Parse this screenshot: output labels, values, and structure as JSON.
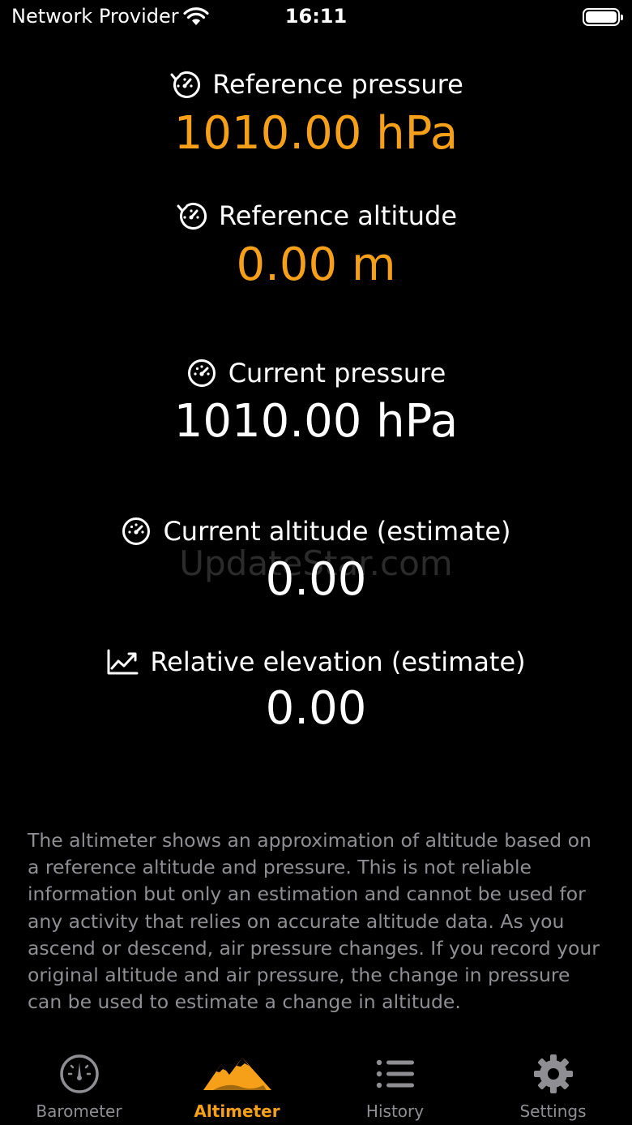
{
  "status_bar": {
    "carrier": "Network Provider",
    "time": "16:11"
  },
  "metrics": {
    "reference_pressure": {
      "label": "Reference pressure",
      "value": "1010.00 hPa",
      "icon": "timer-reset-icon"
    },
    "reference_altitude": {
      "label": "Reference altitude",
      "value": "0.00 m",
      "icon": "timer-reset-icon"
    },
    "current_pressure": {
      "label": "Current pressure",
      "value": "1010.00 hPa",
      "icon": "gauge-icon"
    },
    "current_altitude": {
      "label": "Current altitude (estimate)",
      "value": "0.00",
      "icon": "gauge-icon"
    },
    "relative_elevation": {
      "label": "Relative elevation (estimate)",
      "value": "0.00",
      "icon": "chart-line-icon"
    }
  },
  "watermark": "UpdateStar.com",
  "description": "The altimeter shows an approximation of altitude based on a reference altitude and pressure. This is not reliable information but only an estimation and cannot be used for any activity that relies on accurate altitude data. As you ascend or descend, air pressure changes. If you record your original altitude and air pressure, the change in pressure can be used to estimate a change in altitude.",
  "tabs": [
    {
      "label": "Barometer",
      "icon": "barometer-icon",
      "active": false
    },
    {
      "label": "Altimeter",
      "icon": "mountains-icon",
      "active": true
    },
    {
      "label": "History",
      "icon": "list-icon",
      "active": false
    },
    {
      "label": "Settings",
      "icon": "gear-icon",
      "active": false
    }
  ],
  "colors": {
    "accent": "#F6A01A",
    "background": "#000000",
    "secondary_text": "#8E8E93"
  }
}
